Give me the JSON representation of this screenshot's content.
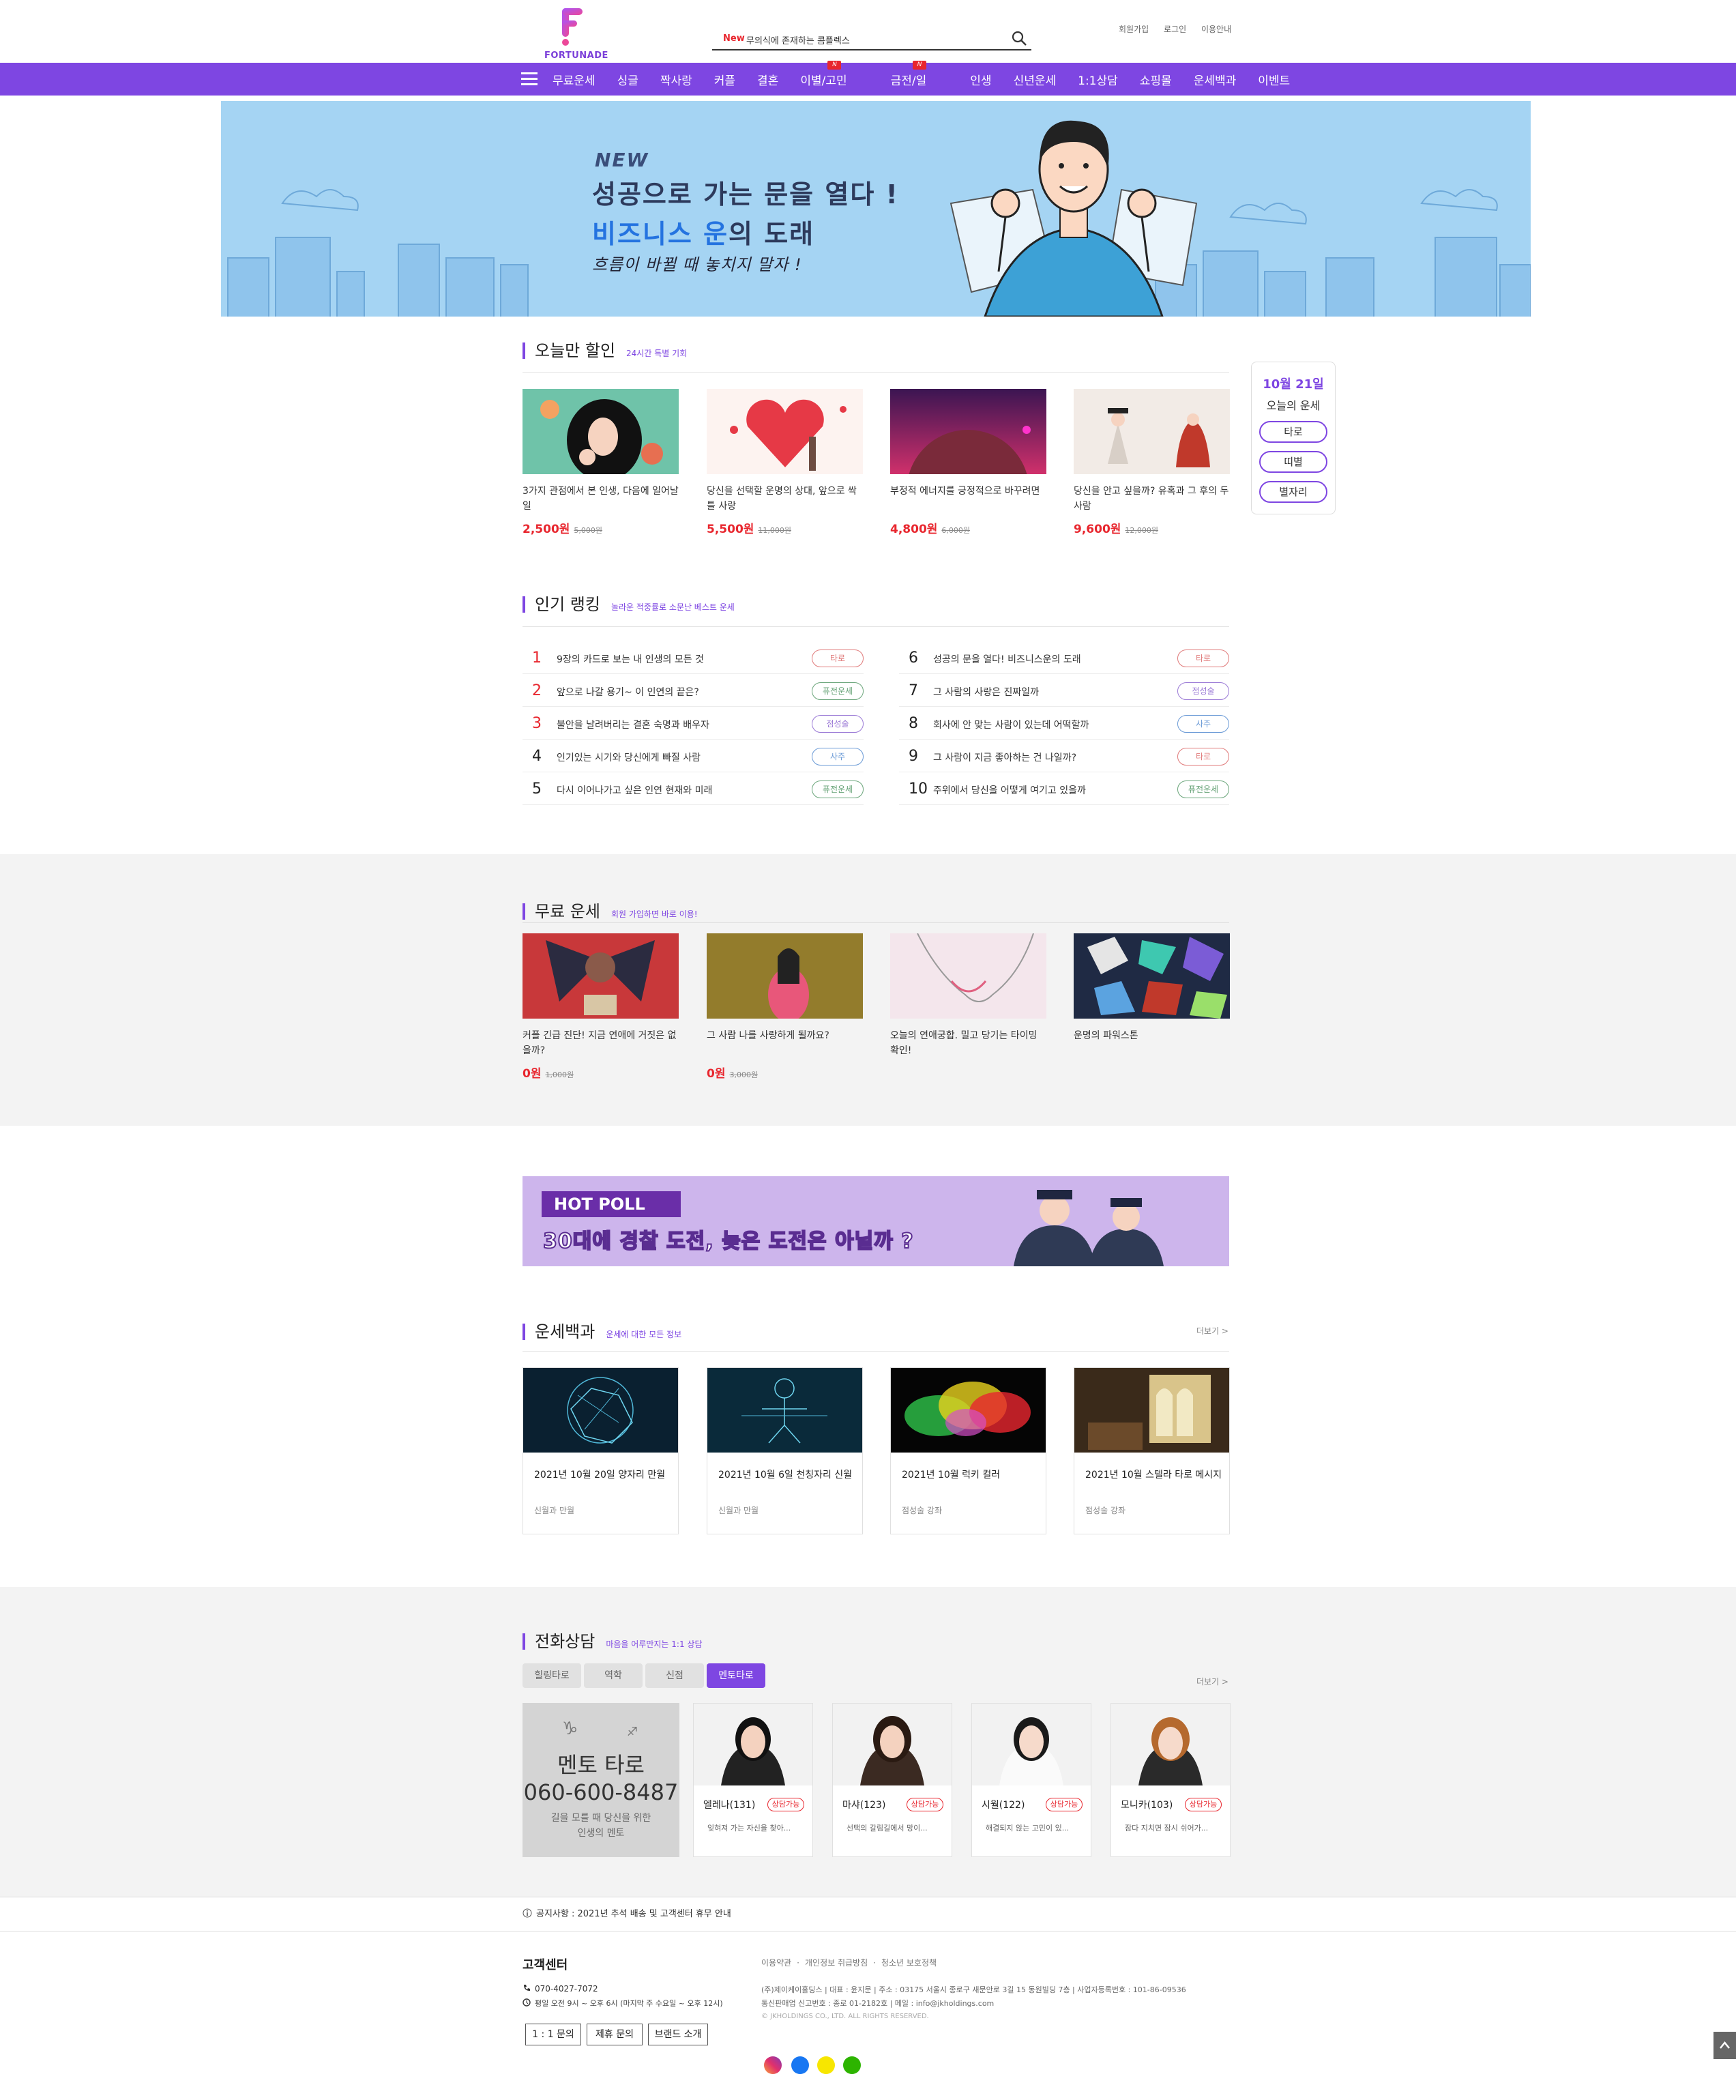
{
  "header": {
    "logo_text": "FORTUNADE",
    "search_new": "New",
    "search_text": "무의식에 존재하는 콤플렉스",
    "util": [
      "회원가입",
      "로그인",
      "이용안내"
    ]
  },
  "gnb": {
    "items": [
      "무료운세",
      "싱글",
      "짝사랑",
      "커플",
      "결혼",
      "이별/고민",
      "금전/일",
      "인생",
      "신년운세",
      "1:1상담",
      "쇼핑몰",
      "운세백과",
      "이벤트"
    ],
    "badge": "N"
  },
  "banner": {
    "new": "NEW",
    "line1": "성공으로 가는 문을 열다 !",
    "line2a": "비즈니스 운",
    "line2b": "의 도래",
    "line3": "흐름이 바뀔 때 놓치지 말자 !"
  },
  "today": {
    "title": "오늘만 할인",
    "sub": "24시간 특별 기회",
    "items": [
      {
        "title": "3가지 관점에서 본 인생, 다음에 일어날 일",
        "price": "2,500원",
        "orig": "5,000원"
      },
      {
        "title": "당신을 선택할 운명의 상대, 앞으로 싹틀 사랑",
        "price": "5,500원",
        "orig": "11,000원"
      },
      {
        "title": "부정적 에너지를 긍정적으로 바꾸려면",
        "price": "4,800원",
        "orig": "6,000원"
      },
      {
        "title": "당신을 안고 싶을까? 유혹과 그 후의 두 사람",
        "price": "9,600원",
        "orig": "12,000원"
      }
    ]
  },
  "side": {
    "date": "10월 21일",
    "label": "오늘의 운세",
    "buttons": [
      "타로",
      "띠별",
      "별자리"
    ]
  },
  "ranking": {
    "title": "인기 랭킹",
    "sub": "놀라운 적중률로 소문난 베스트 운세",
    "items": [
      {
        "n": "1",
        "text": "9장의 카드로 보는 내 인생의 모든 것",
        "tag": "타로"
      },
      {
        "n": "2",
        "text": "앞으로 나갈 용기~ 이 인연의 끝은?",
        "tag": "퓨전운세"
      },
      {
        "n": "3",
        "text": "불안을 날려버리는 결혼 숙명과 배우자",
        "tag": "점성술"
      },
      {
        "n": "4",
        "text": "인기있는 시기와 당신에게 빠질 사람",
        "tag": "사주"
      },
      {
        "n": "5",
        "text": "다시 이어나가고 싶은 인연 현재와 미래",
        "tag": "퓨전운세"
      },
      {
        "n": "6",
        "text": "성공의 문을 열다! 비즈니스운의 도래",
        "tag": "타로"
      },
      {
        "n": "7",
        "text": "그 사람의 사랑은 진짜일까",
        "tag": "점성술"
      },
      {
        "n": "8",
        "text": "회사에 안 맞는 사람이 있는데 어떡할까",
        "tag": "사주"
      },
      {
        "n": "9",
        "text": "그 사람이 지금 좋아하는 건 나일까?",
        "tag": "타로"
      },
      {
        "n": "10",
        "text": "주위에서 당신을 어떻게 여기고 있을까",
        "tag": "퓨전운세"
      }
    ]
  },
  "free": {
    "title": "무료 운세",
    "sub": "회원 가입하면 바로 이용!",
    "items": [
      {
        "title": "커플 긴급 진단! 지금 연애에 거짓은 없을까?",
        "price": "0원",
        "orig": "1,000원"
      },
      {
        "title": "그 사람 나를 사랑하게 될까요?",
        "price": "0원",
        "orig": "3,000원"
      },
      {
        "title": "오늘의 연애궁합. 밀고 당기는 타이밍 확인!",
        "price": "",
        "orig": ""
      },
      {
        "title": "운명의 파워스톤",
        "price": "",
        "orig": ""
      }
    ]
  },
  "poll": {
    "tag": "HOT POLL",
    "text": "30대에 경찰 도전, 늦은 도전은 아닐까 ?"
  },
  "encyclopedia": {
    "title": "운세백과",
    "sub": "운세에 대한 모든 정보",
    "more": "더보기 >",
    "items": [
      {
        "title": "2021년 10월 20일 양자리 만월",
        "cat": "신월과 만월"
      },
      {
        "title": "2021년 10월 6일 천칭자리 신월",
        "cat": "신월과 만월"
      },
      {
        "title": "2021년 10월 럭키 컬러",
        "cat": "점성술 강좌"
      },
      {
        "title": "2021년 10월 스텔라 타로 메시지",
        "cat": "점성술 강좌"
      }
    ]
  },
  "phone": {
    "title": "전화상담",
    "sub": "마음을 어루만지는 1:1 상담",
    "more": "더보기 >",
    "tabs": [
      "힐링타로",
      "역학",
      "신점",
      "멘토타로"
    ],
    "feature": {
      "name": "멘토 타로",
      "phone": "060-600-8487",
      "desc1": "길을 모를 때 당신을 위한",
      "desc2": "인생의 멘토"
    },
    "counselors": [
      {
        "name": "엘레나(131)",
        "status": "상담가능",
        "desc": "잊혀져 가는 자신을 찾아..."
      },
      {
        "name": "마샤(123)",
        "status": "상담가능",
        "desc": "선택의 갈림길에서 망이..."
      },
      {
        "name": "시월(122)",
        "status": "상담가능",
        "desc": "해결되지 않는 고민이 있..."
      },
      {
        "name": "모니카(103)",
        "status": "상담가능",
        "desc": "잠다 지치면 잠시 쉬어가..."
      }
    ]
  },
  "notice": "공지사항 : 2021년 추석 배송 및 고객센터 휴무 안내",
  "footer": {
    "cs_title": "고객센터",
    "tel": "070-4027-7072",
    "hours": "평일 오전 9시 ~ 오후 6시 (마지막 주 수요일 ~ 오후 12시)",
    "buttons": [
      "1 : 1 문의",
      "제휴 문의",
      "브랜드 소개"
    ],
    "links": [
      "이용약관",
      "개인정보 취급방침",
      "청소년 보호정책"
    ],
    "info1": "(주)제이케이홀딩스 | 대표 : 윤지문 | 주소 : 03175 서울시 종로구 새문안로 3길 15 동원빌딩 7층 | 사업자등록번호 : 101-86-09536",
    "info2": "통신판매업 신고번호 : 종로 01-2182호 | 메일 : info@jkholdings.com",
    "copy": "© JKHOLDINGS CO., LTD. ALL RIGHTS RESERVED."
  }
}
